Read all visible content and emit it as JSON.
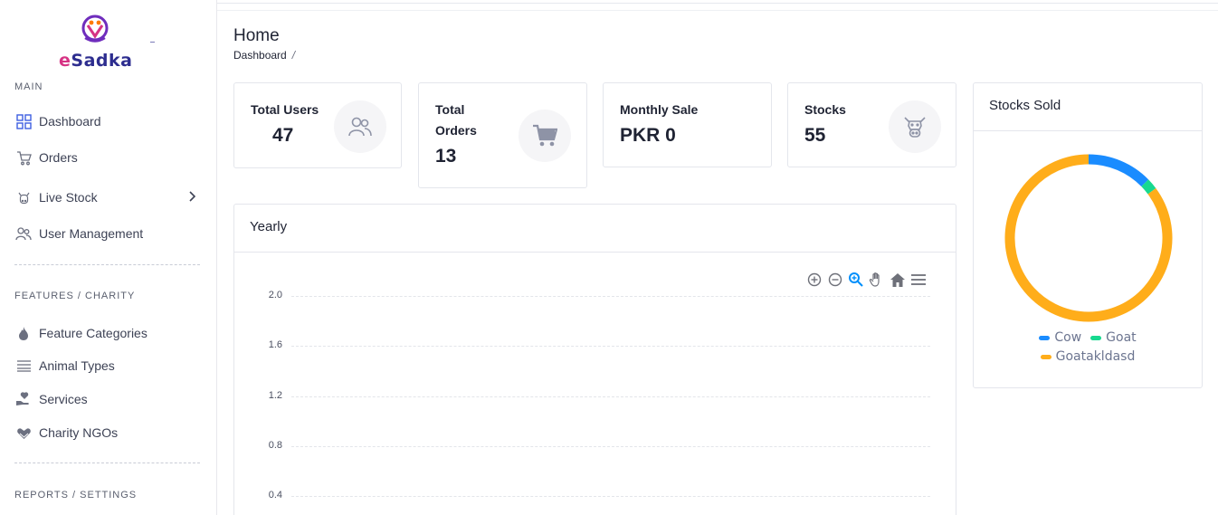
{
  "brand": {
    "name_e": "e",
    "name_rest": "Sadka"
  },
  "sidebar": {
    "sections": [
      {
        "title": "MAIN"
      },
      {
        "title": "FEATURES / CHARITY"
      },
      {
        "title": "REPORTS / SETTINGS"
      }
    ],
    "items": [
      {
        "label": "Dashboard",
        "icon": "grid-icon"
      },
      {
        "label": "Orders",
        "icon": "cart-icon"
      },
      {
        "label": "Live Stock",
        "icon": "cow-icon"
      },
      {
        "label": "User Management",
        "icon": "users-icon"
      },
      {
        "label": "Feature Categories",
        "icon": "flame-icon"
      },
      {
        "label": "Animal Types",
        "icon": "list-icon"
      },
      {
        "label": "Services",
        "icon": "hand-heart-icon"
      },
      {
        "label": "Charity NGOs",
        "icon": "heart-hands-icon"
      }
    ]
  },
  "header": {
    "title": "Home",
    "breadcrumb": "Dashboard",
    "breadcrumb_sep": "/"
  },
  "stats": [
    {
      "label": "Total Users",
      "value": "47",
      "icon": "users-icon"
    },
    {
      "label": "Total\nOrders",
      "label_line1": "Total",
      "label_line2": "Orders",
      "value": "13",
      "icon": "cart-icon"
    },
    {
      "label": "Monthly Sale",
      "value": "PKR 0"
    },
    {
      "label": "Stocks",
      "value": "55",
      "icon": "cow-icon"
    }
  ],
  "yearly": {
    "title": "Yearly",
    "toolbar": [
      "zoom-in-icon",
      "zoom-out-icon",
      "selection-zoom-icon",
      "pan-hand-icon",
      "reset-home-icon",
      "menu-icon"
    ]
  },
  "stocks_sold": {
    "title": "Stocks Sold"
  },
  "colors": {
    "cow": "#1a8cff",
    "goat": "#17d98f",
    "goatakldasd": "#ffad1a",
    "accent": "#3d5ee1"
  },
  "chart_data": [
    {
      "type": "line",
      "title": "Yearly",
      "y_ticks": [
        "2.0",
        "1.6",
        "1.2",
        "0.8",
        "0.4"
      ],
      "ylim": [
        0,
        2.0
      ],
      "grid": true,
      "series": []
    },
    {
      "type": "pie",
      "title": "Stocks Sold",
      "donut": true,
      "legend_position": "bottom",
      "categories": [
        "Cow",
        "Goat",
        "Goatakldasd"
      ],
      "values": [
        7,
        1.2,
        47
      ]
    }
  ]
}
